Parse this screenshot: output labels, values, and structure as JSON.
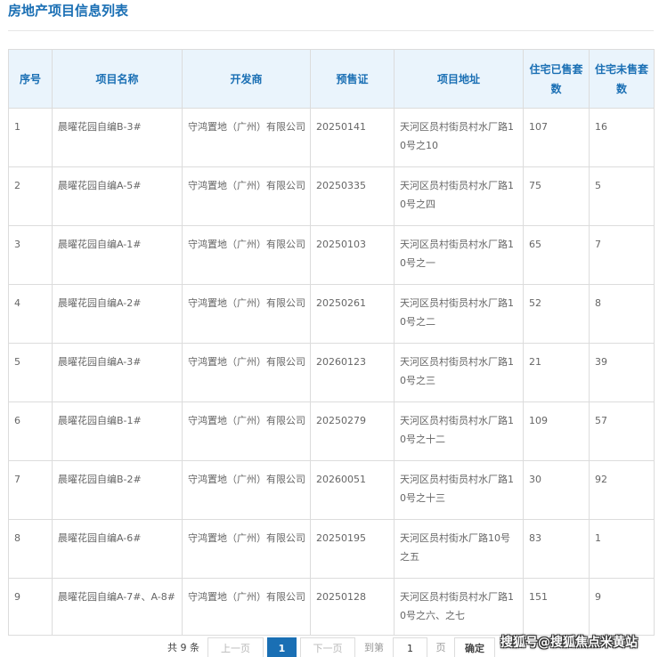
{
  "page": {
    "title": "房地产项目信息列表"
  },
  "table": {
    "columns": [
      "序号",
      "项目名称",
      "开发商",
      "预售证",
      "项目地址",
      "住宅已售套数",
      "住宅未售套数"
    ],
    "rows": [
      {
        "no": "1",
        "name": "晨曜花园自编B-3#",
        "developer": "守鸿置地（广州）有限公司",
        "permit": "20250141",
        "address": "天河区员村街员村水厂路10号之10",
        "sold": "107",
        "unsold": "16"
      },
      {
        "no": "2",
        "name": "晨曜花园自编A-5#",
        "developer": "守鸿置地（广州）有限公司",
        "permit": "20250335",
        "address": "天河区员村街员村水厂路10号之四",
        "sold": "75",
        "unsold": "5"
      },
      {
        "no": "3",
        "name": "晨曜花园自编A-1#",
        "developer": "守鸿置地（广州）有限公司",
        "permit": "20250103",
        "address": "天河区员村街员村水厂路10号之一",
        "sold": "65",
        "unsold": "7"
      },
      {
        "no": "4",
        "name": "晨曜花园自编A-2#",
        "developer": "守鸿置地（广州）有限公司",
        "permit": "20250261",
        "address": "天河区员村街员村水厂路10号之二",
        "sold": "52",
        "unsold": "8"
      },
      {
        "no": "5",
        "name": "晨曜花园自编A-3#",
        "developer": "守鸿置地（广州）有限公司",
        "permit": "20260123",
        "address": "天河区员村街员村水厂路10号之三",
        "sold": "21",
        "unsold": "39"
      },
      {
        "no": "6",
        "name": "晨曜花园自编B-1#",
        "developer": "守鸿置地（广州）有限公司",
        "permit": "20250279",
        "address": "天河区员村街员村水厂路10号之十二",
        "sold": "109",
        "unsold": "57"
      },
      {
        "no": "7",
        "name": "晨曜花园自编B-2#",
        "developer": "守鸿置地（广州）有限公司",
        "permit": "20260051",
        "address": "天河区员村街员村水厂路10号之十三",
        "sold": "30",
        "unsold": "92"
      },
      {
        "no": "8",
        "name": "晨曜花园自编A-6#",
        "developer": "守鸿置地（广州）有限公司",
        "permit": "20250195",
        "address": "天河区员村街水厂路10号之五",
        "sold": "83",
        "unsold": "1"
      },
      {
        "no": "9",
        "name": "晨曜花园自编A-7#、A-8#",
        "developer": "守鸿置地（广州）有限公司",
        "permit": "20250128",
        "address": "天河区员村街员村水厂路10号之六、之七",
        "sold": "151",
        "unsold": "9"
      }
    ]
  },
  "pagination": {
    "total_text": "共 9 条",
    "prev_label": "上一页",
    "current_page": "1",
    "next_label": "下一页",
    "goto_label": "到第",
    "goto_value": "1",
    "page_unit": "页",
    "confirm_label": "确定"
  },
  "watermark": {
    "text": "搜狐号@搜狐焦点米黄站"
  },
  "colors": {
    "accent": "#1a6fb4",
    "header_bg": "#eaf4fc",
    "border": "#dcdcdc"
  }
}
